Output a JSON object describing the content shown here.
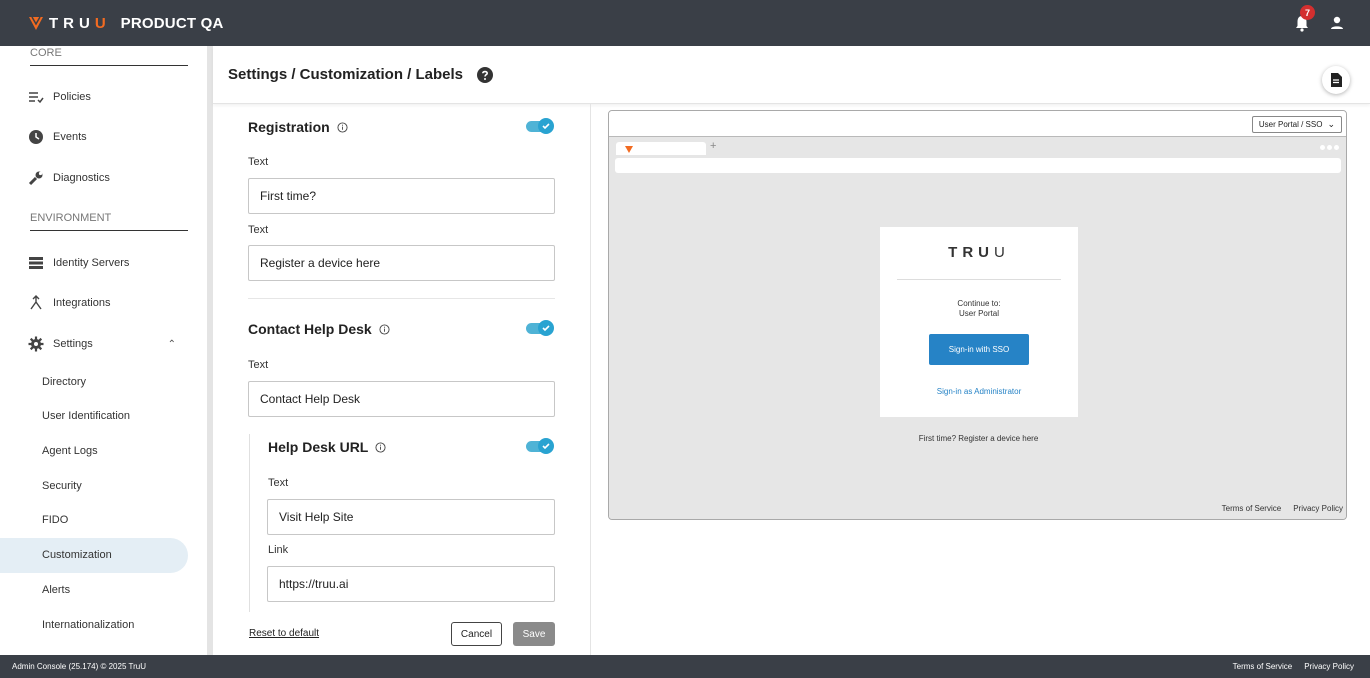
{
  "topbar": {
    "logo_text": "TRU",
    "logo_text_accent": "U",
    "app_title": "PRODUCT QA",
    "notification_count": "7",
    "colors": {
      "bar": "#3a3f47",
      "brand_orange": "#f26b21",
      "badge": "#d32f2f"
    }
  },
  "sidebar": {
    "core_label": "CORE",
    "environment_label": "ENVIRONMENT",
    "items": [
      {
        "label": "Policies",
        "icon": "policies-icon"
      },
      {
        "label": "Events",
        "icon": "clock-icon"
      },
      {
        "label": "Diagnostics",
        "icon": "wrench-icon"
      },
      {
        "label": "Identity Servers",
        "icon": "server-list-icon"
      },
      {
        "label": "Integrations",
        "icon": "merge-icon"
      },
      {
        "label": "Settings",
        "icon": "gear-icon"
      }
    ],
    "settings_sub": [
      {
        "label": "Directory"
      },
      {
        "label": "User Identification"
      },
      {
        "label": "Agent Logs"
      },
      {
        "label": "Security"
      },
      {
        "label": "FIDO"
      },
      {
        "label": "Customization"
      },
      {
        "label": "Alerts"
      },
      {
        "label": "Internationalization"
      }
    ],
    "active_item": "Customization"
  },
  "header": {
    "breadcrumb": "Settings / Customization / Labels"
  },
  "form": {
    "registration": {
      "title": "Registration",
      "enabled": true,
      "text1_label": "Text",
      "text1_value": "First time?",
      "text2_label": "Text",
      "text2_value": "Register a device here"
    },
    "contact_help_desk": {
      "title": "Contact Help Desk",
      "enabled": true,
      "text_label": "Text",
      "text_value": "Contact Help Desk"
    },
    "help_desk_url": {
      "title": "Help Desk URL",
      "enabled": true,
      "text_label": "Text",
      "text_value": "Visit Help Site",
      "link_label": "Link",
      "link_value": "https://truu.ai"
    },
    "reset_label": "Reset to default",
    "cancel_label": "Cancel",
    "save_label": "Save"
  },
  "preview": {
    "selector_value": "User Portal / SSO",
    "logo_text": "TRU",
    "logo_text_end": "U",
    "continue_line1": "Continue to:",
    "continue_line2": "User Portal",
    "sso_button": "Sign-in with SSO",
    "admin_link": "Sign-in as Administrator",
    "first_time_text": "First time? Register a device here",
    "terms": "Terms of Service",
    "privacy": "Privacy Policy",
    "sso_color": "#2683c6"
  },
  "footer": {
    "left_text": "Admin Console (25.174) © 2025 TruU",
    "terms": "Terms of Service",
    "privacy": "Privacy Policy"
  }
}
